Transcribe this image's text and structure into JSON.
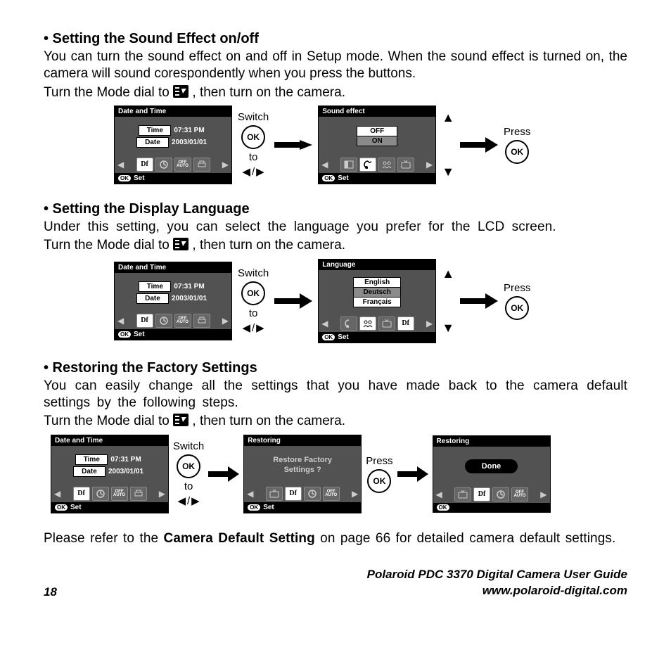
{
  "sections": {
    "sound": {
      "title": "• Setting the Sound Effect on/off",
      "para": "You can turn the sound effect on and off in Setup mode. When the sound effect is turned on, the camera will sound corespondently when you press the buttons.",
      "instr_a": "Turn the Mode dial to ",
      "instr_b": " , then turn on the camera."
    },
    "lang": {
      "title": "• Setting the Display Language",
      "para": "Under this setting, you can select the language you prefer for the LCD screen.",
      "instr_a": "Turn the Mode dial to ",
      "instr_b": " , then turn on the camera."
    },
    "restore": {
      "title": "• Restoring the Factory Settings",
      "para": "You can easily change all the settings that you have made back to the camera default settings by the following steps.",
      "instr_a": "Turn the Mode dial to ",
      "instr_b": " , then turn on the camera.",
      "note_a": "Please refer to the ",
      "note_bold": "Camera Default Setting",
      "note_b": " on page 66 for detailed camera default settings."
    }
  },
  "labels": {
    "switch": "Switch",
    "to": "to",
    "press": "Press",
    "ok": "OK",
    "set": "Set"
  },
  "screens": {
    "date_time_title": "Date and Time",
    "time_label": "Time",
    "time_value": "07:31 PM",
    "date_label": "Date",
    "date_value": "2003/01/01",
    "sound_title": "Sound effect",
    "sound_off": "OFF",
    "sound_on": "ON",
    "lang_title": "Language",
    "lang1": "English",
    "lang2": "Deutsch",
    "lang3": "Français",
    "restoring_title": "Restoring",
    "restoring_msg1": "Restore Factory",
    "restoring_msg2": "Settings ?",
    "done": "Done",
    "df": "Df",
    "offauto_off": "OFF",
    "offauto_auto": "AUTO"
  },
  "footer": {
    "page": "18",
    "title1": "Polaroid PDC 3370 Digital Camera User Guide",
    "title2": "www.polaroid-digital.com"
  }
}
